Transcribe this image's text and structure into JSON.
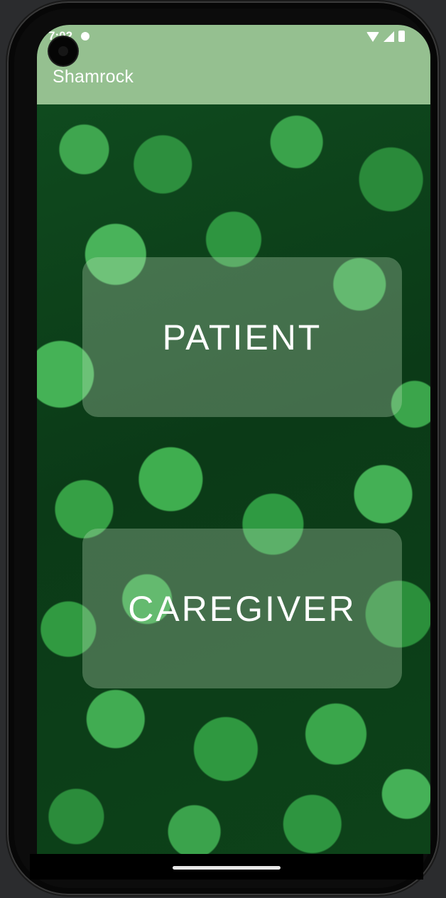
{
  "status_bar": {
    "time": "7:02"
  },
  "app_bar": {
    "title": "Shamrock"
  },
  "buttons": {
    "patient_label": "PATIENT",
    "caregiver_label": "CAREGIVER"
  },
  "colors": {
    "app_bar": "#95c090",
    "button_overlay": "rgba(200,230,195,0.30)",
    "text": "#ffffff"
  },
  "icons": {
    "status": [
      "wifi-icon",
      "cell-signal-icon",
      "battery-icon"
    ],
    "background": "clover-background-image"
  }
}
